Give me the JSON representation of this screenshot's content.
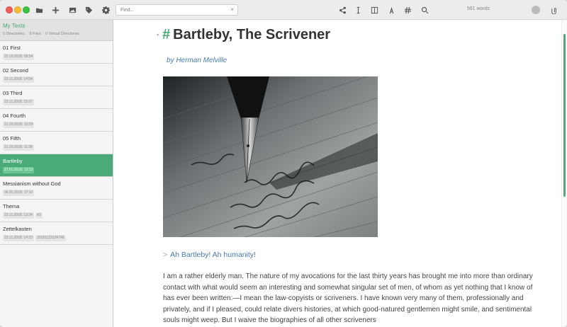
{
  "toolbar": {
    "icons": [
      "folder-icon",
      "plus-icon",
      "image-icon",
      "tag-icon",
      "gear-icon"
    ],
    "search_placeholder": "Find...",
    "search_clear": "×",
    "right_icons": [
      "share-icon",
      "text-cursor-icon",
      "column-icon",
      "font-icon",
      "hash-icon",
      "magnifier-icon"
    ],
    "word_count": "561 words",
    "attachment_icon": "paperclip-icon"
  },
  "sidebar": {
    "directory": {
      "title": "My Texts",
      "directories": "0 Directories",
      "files": "9 Files",
      "virtual": "0 Virtual Directories"
    },
    "files": [
      {
        "name": "01 First",
        "date": "22.10.2018, 08:54",
        "tags": []
      },
      {
        "name": "02 Second",
        "date": "23.11.2018, 14:54",
        "tags": []
      },
      {
        "name": "03 Third",
        "date": "23.11.2018, 15:07",
        "tags": []
      },
      {
        "name": "04 Fourth",
        "date": "21.10.2018, 16:29",
        "tags": []
      },
      {
        "name": "05 Fifth",
        "date": "21.10.2018, 11:38",
        "tags": []
      },
      {
        "name": "Bartleby",
        "date": "27.01.2019, 13:13",
        "tags": [],
        "active": true
      },
      {
        "name": "Messianism without God",
        "date": "06.02.2019, 17:10",
        "tags": []
      },
      {
        "name": "Thema",
        "date": "23.11.2018, 13:34",
        "tags": [
          "#3"
        ]
      },
      {
        "name": "Zettelkasten",
        "date": "23.11.2018, 14:23",
        "tags": [
          "20181123124746"
        ]
      }
    ]
  },
  "editor": {
    "hash": "#",
    "title": "Bartleby, The Scrivener",
    "author": "by Herman Melville",
    "quote_marker": ">",
    "quote": "Ah Bartleby! Ah humanity!",
    "paragraph": "I am a rather elderly man. The nature of my avocations for the last thirty years has brought me into more than ordinary contact with what would seem an interesting and somewhat singular set of men, of whom as yet nothing that I know of has ever been written:—I mean the law-copyists or scriveners. I have known very many of them, professionally and privately, and if I pleased, could relate divers histories, at which good-natured gentlemen might smile, and sentimental souls might weep. But I waive the biographies of all other scriveners"
  },
  "colors": {
    "accent": "#4aab78",
    "link": "#4a7bb0"
  }
}
